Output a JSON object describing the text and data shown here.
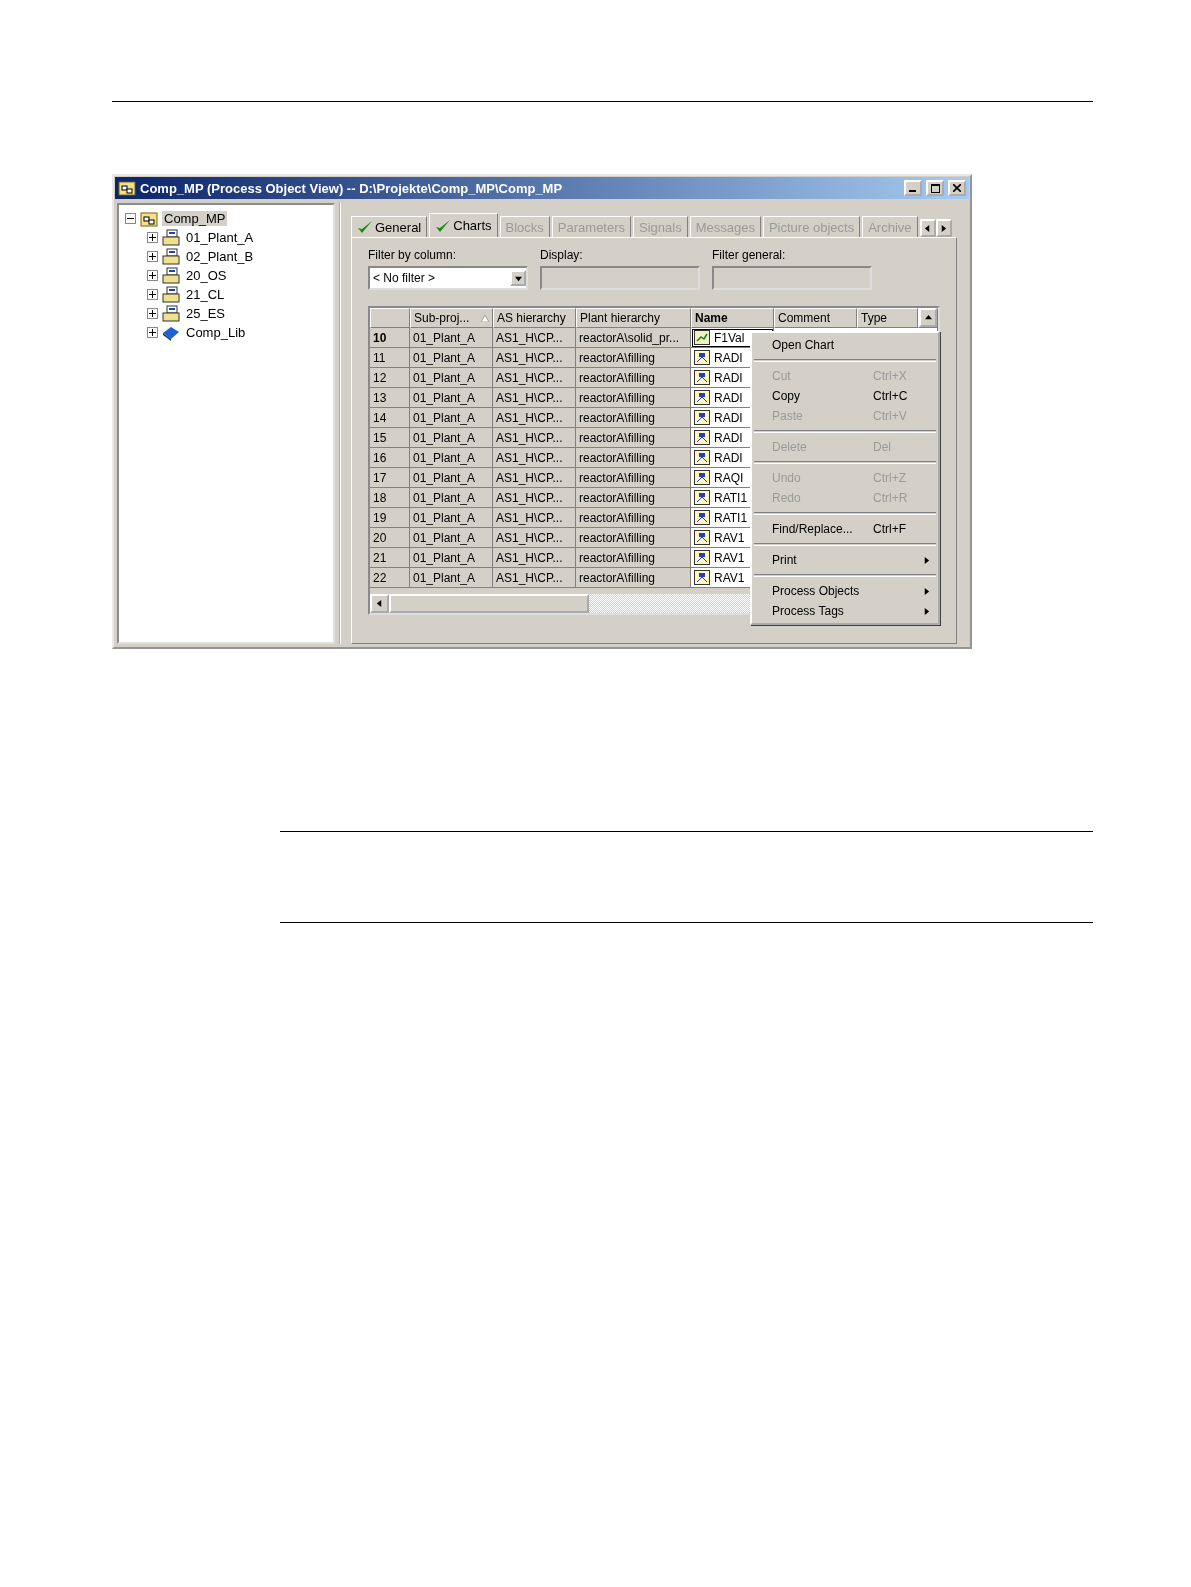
{
  "window": {
    "title": "Comp_MP (Process Object View) -- D:\\Projekte\\Comp_MP\\Comp_MP"
  },
  "tree": {
    "label": "Comp_MP",
    "kind": "project-root",
    "expanded": true,
    "selected": true,
    "children": [
      {
        "label": "01_Plant_A",
        "kind": "project",
        "expanded": false,
        "selected": false
      },
      {
        "label": "02_Plant_B",
        "kind": "project",
        "expanded": false,
        "selected": false
      },
      {
        "label": "20_OS",
        "kind": "project",
        "expanded": false,
        "selected": false
      },
      {
        "label": "21_CL",
        "kind": "project",
        "expanded": false,
        "selected": false
      },
      {
        "label": "25_ES",
        "kind": "project",
        "expanded": false,
        "selected": false
      },
      {
        "label": "Comp_Lib",
        "kind": "library",
        "expanded": false,
        "selected": false
      }
    ]
  },
  "tabs": [
    {
      "label": "General",
      "checked": true,
      "selected": false,
      "disabled": false
    },
    {
      "label": "Charts",
      "checked": true,
      "selected": true,
      "disabled": false
    },
    {
      "label": "Blocks",
      "checked": false,
      "selected": false,
      "disabled": true
    },
    {
      "label": "Parameters",
      "checked": false,
      "selected": false,
      "disabled": true
    },
    {
      "label": "Signals",
      "checked": false,
      "selected": false,
      "disabled": true
    },
    {
      "label": "Messages",
      "checked": false,
      "selected": false,
      "disabled": true
    },
    {
      "label": "Picture objects",
      "checked": false,
      "selected": false,
      "disabled": true
    },
    {
      "label": "Archive",
      "checked": false,
      "selected": false,
      "disabled": true
    }
  ],
  "filters": {
    "filter_by_column": {
      "label": "Filter by column:",
      "value": "< No filter >"
    },
    "display": {
      "label": "Display:"
    },
    "filter_general": {
      "label": "Filter general:"
    }
  },
  "table": {
    "columns": [
      {
        "label": "Sub-proj...",
        "sorted": true,
        "active": false
      },
      {
        "label": "AS hierarchy",
        "sorted": false,
        "active": false
      },
      {
        "label": "Plant hierarchy",
        "sorted": false,
        "active": false
      },
      {
        "label": "Name",
        "sorted": false,
        "active": true
      },
      {
        "label": "Comment",
        "sorted": false,
        "active": false
      },
      {
        "label": "Type",
        "sorted": false,
        "active": false
      }
    ],
    "rows": [
      {
        "number": "10",
        "selected": true,
        "kind": "chart",
        "cells": [
          "01_Plant_A",
          "AS1_H\\CP...",
          "reactorA\\solid_pr...",
          "F1Val"
        ]
      },
      {
        "number": "11",
        "selected": false,
        "kind": "block",
        "cells": [
          "01_Plant_A",
          "AS1_H\\CP...",
          "reactorA\\filling",
          "RADI"
        ]
      },
      {
        "number": "12",
        "selected": false,
        "kind": "block",
        "cells": [
          "01_Plant_A",
          "AS1_H\\CP...",
          "reactorA\\filling",
          "RADI"
        ]
      },
      {
        "number": "13",
        "selected": false,
        "kind": "block",
        "cells": [
          "01_Plant_A",
          "AS1_H\\CP...",
          "reactorA\\filling",
          "RADI"
        ]
      },
      {
        "number": "14",
        "selected": false,
        "kind": "block",
        "cells": [
          "01_Plant_A",
          "AS1_H\\CP...",
          "reactorA\\filling",
          "RADI"
        ]
      },
      {
        "number": "15",
        "selected": false,
        "kind": "block",
        "cells": [
          "01_Plant_A",
          "AS1_H\\CP...",
          "reactorA\\filling",
          "RADI"
        ]
      },
      {
        "number": "16",
        "selected": false,
        "kind": "block",
        "cells": [
          "01_Plant_A",
          "AS1_H\\CP...",
          "reactorA\\filling",
          "RADI"
        ]
      },
      {
        "number": "17",
        "selected": false,
        "kind": "block",
        "cells": [
          "01_Plant_A",
          "AS1_H\\CP...",
          "reactorA\\filling",
          "RAQI"
        ]
      },
      {
        "number": "18",
        "selected": false,
        "kind": "block",
        "cells": [
          "01_Plant_A",
          "AS1_H\\CP...",
          "reactorA\\filling",
          "RATI1"
        ]
      },
      {
        "number": "19",
        "selected": false,
        "kind": "block",
        "cells": [
          "01_Plant_A",
          "AS1_H\\CP...",
          "reactorA\\filling",
          "RATI1"
        ]
      },
      {
        "number": "20",
        "selected": false,
        "kind": "block",
        "cells": [
          "01_Plant_A",
          "AS1_H\\CP...",
          "reactorA\\filling",
          "RAV1"
        ]
      },
      {
        "number": "21",
        "selected": false,
        "kind": "block",
        "cells": [
          "01_Plant_A",
          "AS1_H\\CP...",
          "reactorA\\filling",
          "RAV1"
        ]
      },
      {
        "number": "22",
        "selected": false,
        "kind": "block",
        "cells": [
          "01_Plant_A",
          "AS1_H\\CP...",
          "reactorA\\filling",
          "RAV1"
        ]
      }
    ]
  },
  "context_menu": [
    {
      "kind": "item",
      "label": "Open Chart",
      "disabled": false,
      "submenu": false
    },
    {
      "kind": "separator"
    },
    {
      "kind": "item",
      "label": "Cut",
      "shortcut": "Ctrl+X",
      "disabled": true,
      "submenu": false
    },
    {
      "kind": "item",
      "label": "Copy",
      "shortcut": "Ctrl+C",
      "disabled": false,
      "submenu": false
    },
    {
      "kind": "item",
      "label": "Paste",
      "shortcut": "Ctrl+V",
      "disabled": true,
      "submenu": false
    },
    {
      "kind": "separator"
    },
    {
      "kind": "item",
      "label": "Delete",
      "shortcut": "Del",
      "disabled": true,
      "submenu": false
    },
    {
      "kind": "separator"
    },
    {
      "kind": "item",
      "label": "Undo",
      "shortcut": "Ctrl+Z",
      "disabled": true,
      "submenu": false
    },
    {
      "kind": "item",
      "label": "Redo",
      "shortcut": "Ctrl+R",
      "disabled": true,
      "submenu": false
    },
    {
      "kind": "separator"
    },
    {
      "kind": "item",
      "label": "Find/Replace...",
      "shortcut": "Ctrl+F",
      "disabled": false,
      "submenu": false
    },
    {
      "kind": "separator"
    },
    {
      "kind": "item",
      "label": "Print",
      "disabled": false,
      "submenu": true
    },
    {
      "kind": "separator"
    },
    {
      "kind": "item",
      "label": "Process Objects",
      "disabled": false,
      "submenu": true
    },
    {
      "kind": "item",
      "label": "Process Tags",
      "disabled": false,
      "submenu": true
    }
  ]
}
